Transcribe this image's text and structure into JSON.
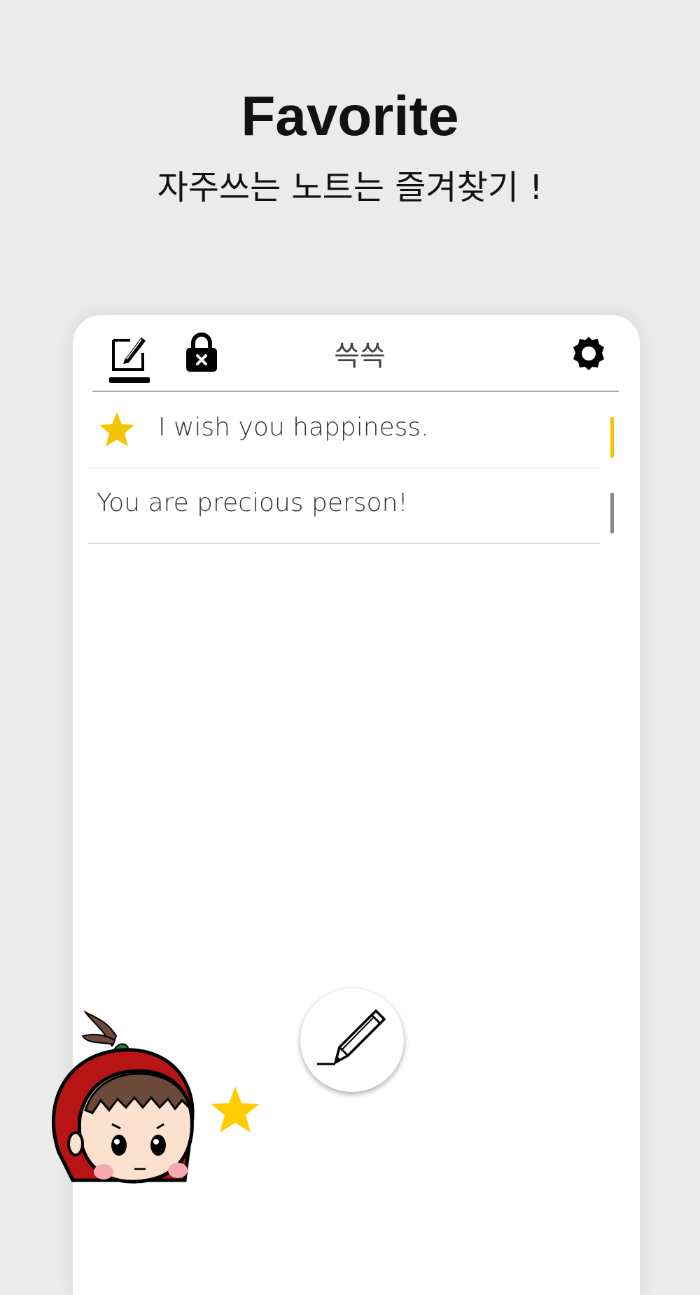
{
  "promo": {
    "headline": "Favorite",
    "subline": "자주쓰는 노트는 즐겨찾기 !"
  },
  "app": {
    "title": "쓱쓱",
    "icons": {
      "note_tab": "edit-note-icon",
      "lock_tab": "lock-icon",
      "settings": "gear-icon",
      "fab": "pencil-icon"
    },
    "colors": {
      "favorite": "#f2c500",
      "normal_marker": "#888888"
    }
  },
  "notes": [
    {
      "text": "I wish you happiness.",
      "favorite": true
    },
    {
      "text": "You are precious person!",
      "favorite": false
    }
  ]
}
